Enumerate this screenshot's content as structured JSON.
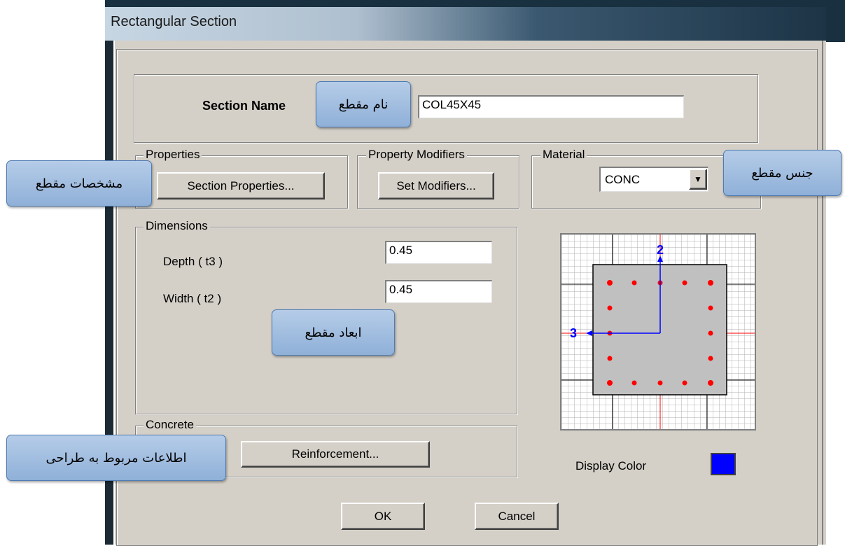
{
  "window": {
    "title": "Rectangular Section"
  },
  "section_name": {
    "label": "Section Name",
    "value": "COL45X45"
  },
  "properties": {
    "legend": "Properties",
    "button": "Section Properties..."
  },
  "modifiers": {
    "legend": "Property Modifiers",
    "button": "Set Modifiers..."
  },
  "material": {
    "legend": "Material",
    "value": "CONC"
  },
  "dimensions": {
    "legend": "Dimensions",
    "depth_label": "Depth  ( t3 )",
    "depth_value": "0.45",
    "width_label": "Width  ( t2 )",
    "width_value": "0.45"
  },
  "concrete": {
    "legend": "Concrete",
    "button": "Reinforcement..."
  },
  "display_color": {
    "label": "Display Color",
    "color": "#0000ff"
  },
  "footer": {
    "ok": "OK",
    "cancel": "Cancel"
  },
  "preview": {
    "axis_2": "2",
    "axis_3": "3"
  },
  "callouts": {
    "section_name": "نام مقطع",
    "properties": "مشخصات مقطع",
    "material": "جنس مقطع",
    "dimensions": "ابعاد مقطع",
    "reinforcement": "اطلاعات مربوط به طراحی"
  }
}
